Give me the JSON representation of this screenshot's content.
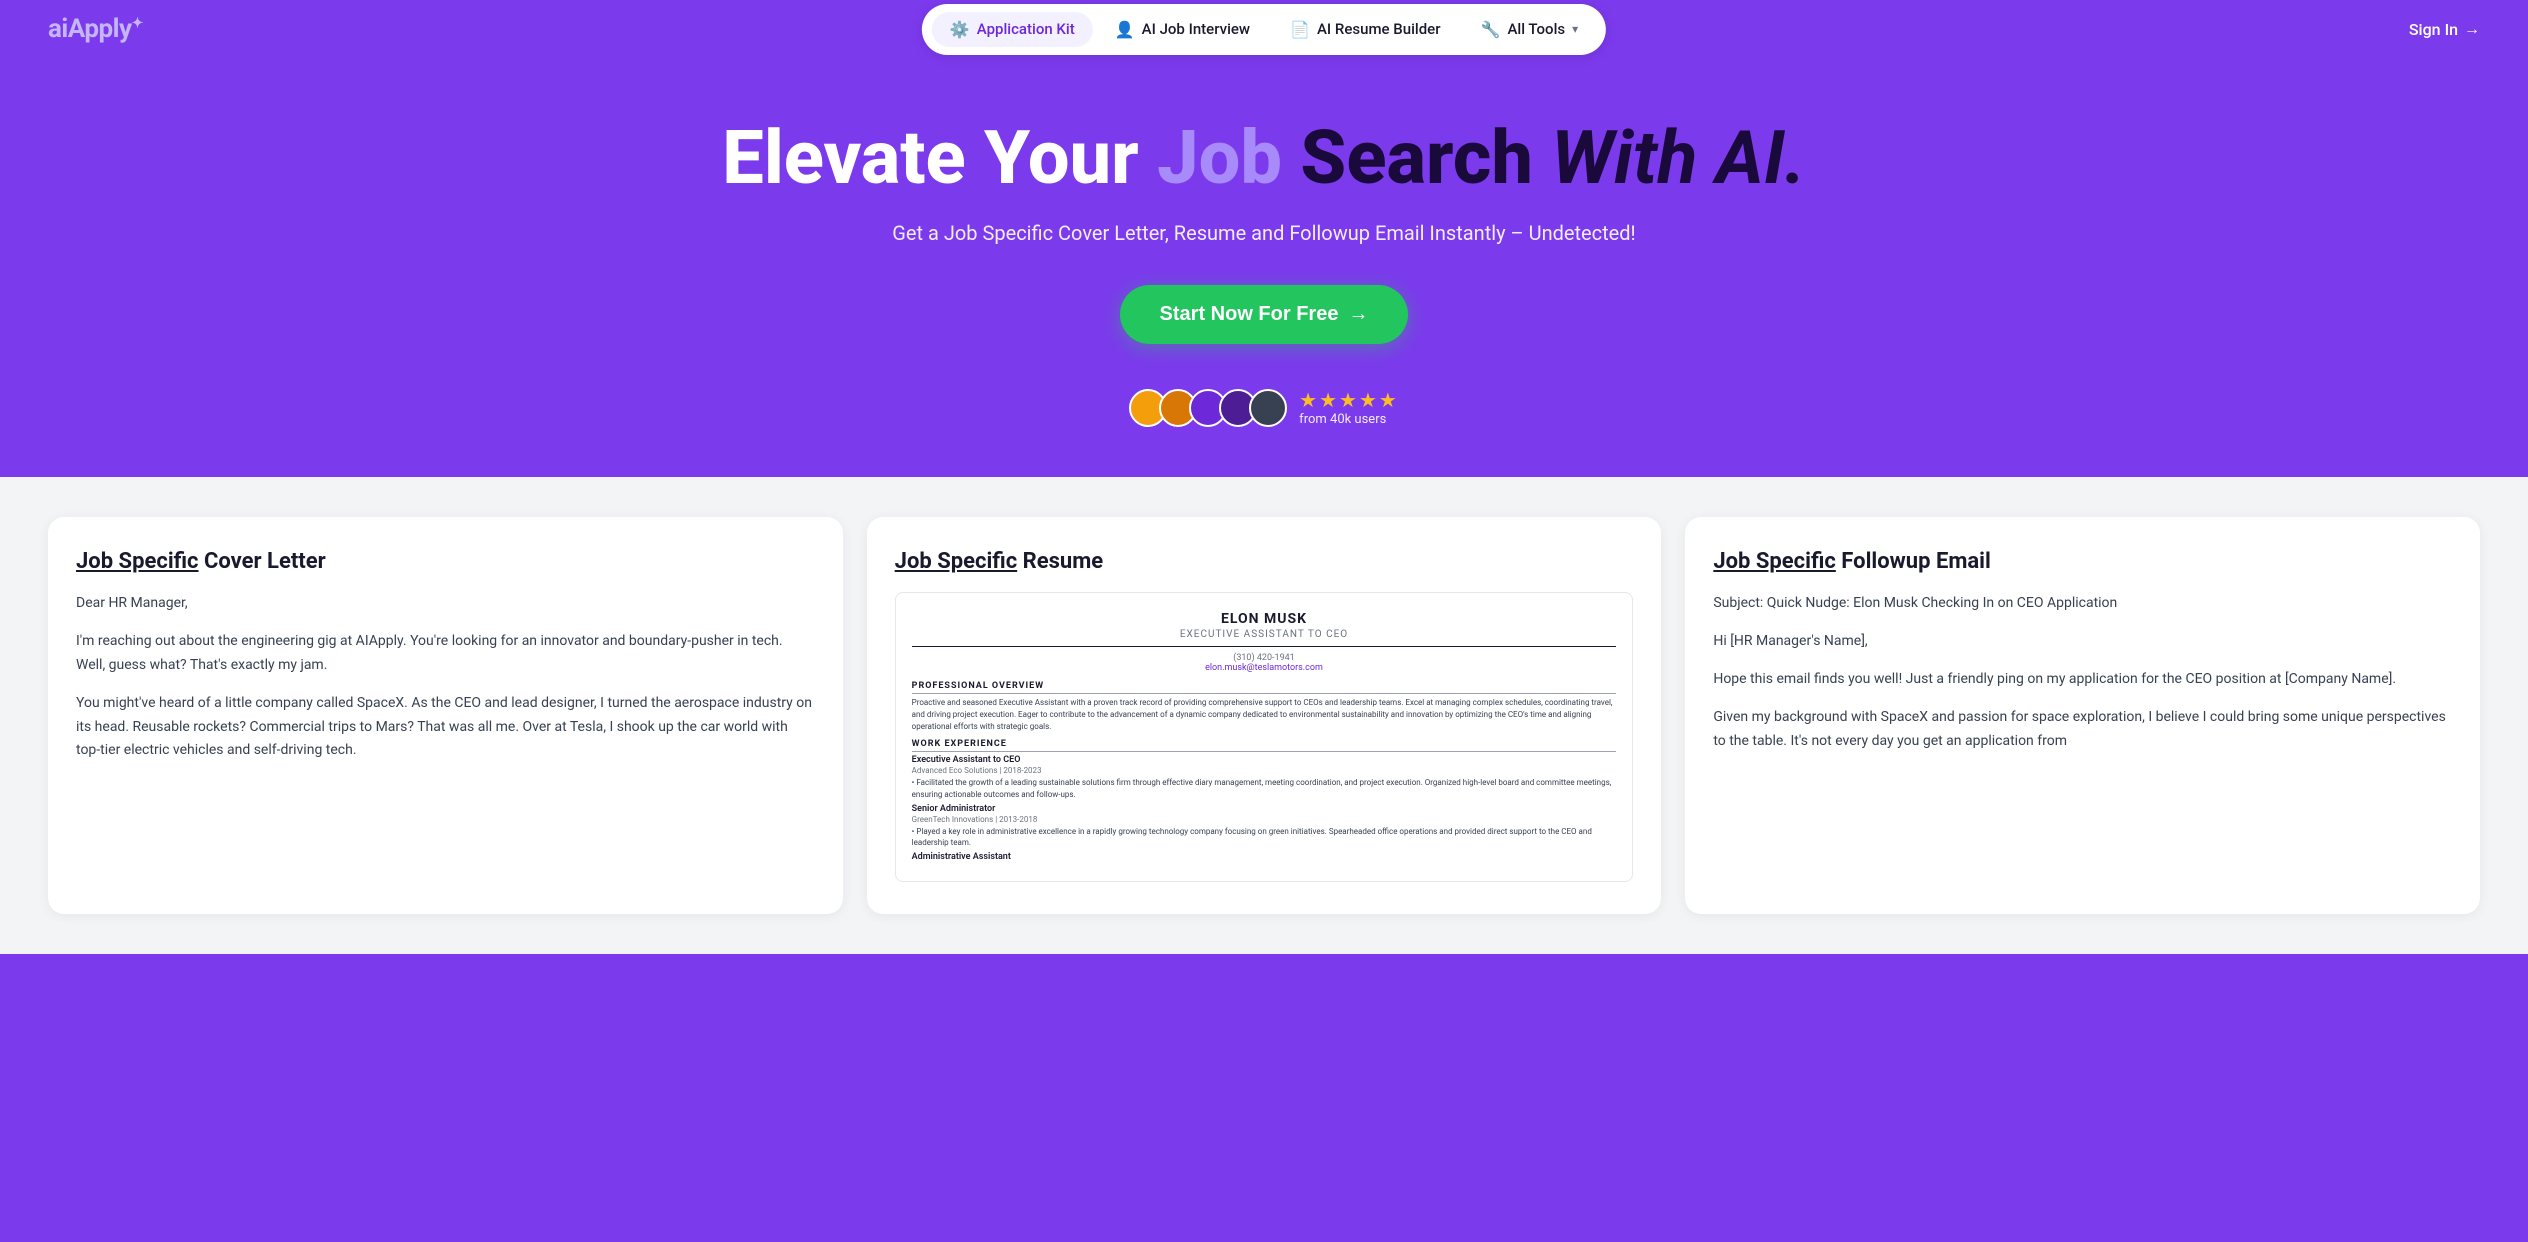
{
  "brand": {
    "logo_text": "aiApply",
    "logo_star": "✦"
  },
  "nav": {
    "items": [
      {
        "id": "app-kit",
        "label": "Application Kit",
        "icon": "⚙️",
        "active": true
      },
      {
        "id": "ai-interview",
        "label": "AI Job Interview",
        "icon": "👤"
      },
      {
        "id": "resume-builder",
        "label": "AI Resume Builder",
        "icon": "📄"
      },
      {
        "id": "all-tools",
        "label": "All Tools",
        "icon": "🔧",
        "has_arrow": true
      }
    ],
    "sign_in": "Sign In",
    "sign_in_arrow": "→"
  },
  "hero": {
    "title_part1": "Elevate Your ",
    "title_job": "Job",
    "title_search": " Search",
    "title_with_ai": " With AI.",
    "subtitle": "Get a Job Specific Cover Letter, Resume and Followup Email Instantly – Undetected!",
    "cta_label": "Start Now For Free",
    "cta_arrow": "→"
  },
  "social_proof": {
    "stars": "★★★★★",
    "users_text": "from 40k users",
    "avatars": [
      "A",
      "B",
      "C",
      "D",
      "E"
    ]
  },
  "cards": [
    {
      "id": "cover-letter",
      "title_underlined": "Job Specific",
      "title_rest": " Cover Letter",
      "body": [
        "Dear HR Manager,",
        "I'm reaching out about the engineering gig at AIApply. You're looking for an innovator and boundary-pusher in tech. Well, guess what? That's exactly my jam.",
        "You might've heard of a little company called SpaceX. As the CEO and lead designer, I turned the aerospace industry on its head. Reusable rockets? Commercial trips to Mars? That was all me. Over at Tesla, I shook up the car world with top-tier electric vehicles and self-driving tech."
      ]
    },
    {
      "id": "resume",
      "title_underlined": "Job Specific",
      "title_rest": " Resume",
      "resume": {
        "name": "ELON MUSK",
        "role": "EXECUTIVE ASSISTANT TO CEO",
        "phone": "(310) 420-1941",
        "email": "elon.musk@teslamotors.com",
        "sections": [
          {
            "title": "PROFESSIONAL OVERVIEW",
            "text": "Proactive and seasoned Executive Assistant with a proven track record of providing comprehensive support to CEOs and leadership teams. Excel at managing complex schedules, coordinating travel, and driving project execution. Eager to contribute to the advancement of a dynamic company dedicated to environmental sustainability and innovation by optimizing the CEO's time and aligning operational efforts with strategic goals."
          },
          {
            "title": "WORK EXPERIENCE",
            "jobs": [
              {
                "title": "Executive Assistant to CEO",
                "company": "Advanced Eco Solutions | 2018-2023",
                "text": "• Facilitated the growth of a leading sustainable solutions firm through effective diary management, meeting coordination, and project execution. Organized high-level board and committee meetings, ensuring actionable outcomes and follow-ups."
              },
              {
                "title": "Senior Administrator",
                "company": "GreenTech Innovations | 2013-2018",
                "text": "• Played a key role in administrative excellence in a rapidly growing technology company focusing on green initiatives. Spearheaded office operations and provided direct support to the CEO and leadership team."
              },
              {
                "title": "Administrative Assistant",
                "company": "",
                "text": ""
              }
            ]
          }
        ]
      }
    },
    {
      "id": "followup-email",
      "title_underlined": "Job Specific",
      "title_rest": " Followup Email",
      "body": [
        "Subject: Quick Nudge: Elon Musk Checking In on CEO Application",
        "Hi [HR Manager's Name],",
        "Hope this email finds you well! Just a friendly ping on my application for the CEO position at [Company Name].",
        "Given my background with SpaceX and passion for space exploration, I believe I could bring some unique perspectives to the table. It's not every day you get an application from"
      ]
    }
  ]
}
